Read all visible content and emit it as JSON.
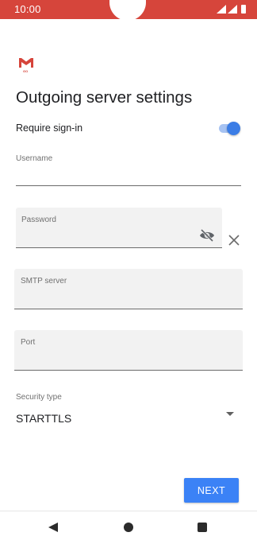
{
  "status_bar": {
    "time": "10:00"
  },
  "app": {
    "logo_sub": "GO"
  },
  "page": {
    "title": "Outgoing server settings"
  },
  "require_signin": {
    "label": "Require sign-in",
    "enabled": true
  },
  "fields": {
    "username": {
      "label": "Username",
      "value": ""
    },
    "password": {
      "label": "Password",
      "value": ""
    },
    "smtp_server": {
      "label": "SMTP server",
      "value": ""
    },
    "port": {
      "label": "Port",
      "value": ""
    },
    "security_type": {
      "label": "Security type",
      "value": "STARTTLS"
    }
  },
  "actions": {
    "next_label": "NEXT"
  },
  "colors": {
    "status_bar": "#d6453b",
    "accent": "#3b82f6",
    "toggle_thumb": "#3b7de6"
  },
  "icons": [
    "gmail-logo-icon",
    "signal-icon",
    "battery-icon",
    "visibility-off-icon",
    "close-icon",
    "dropdown-arrow-icon",
    "nav-back-icon",
    "nav-home-icon",
    "nav-recents-icon"
  ]
}
